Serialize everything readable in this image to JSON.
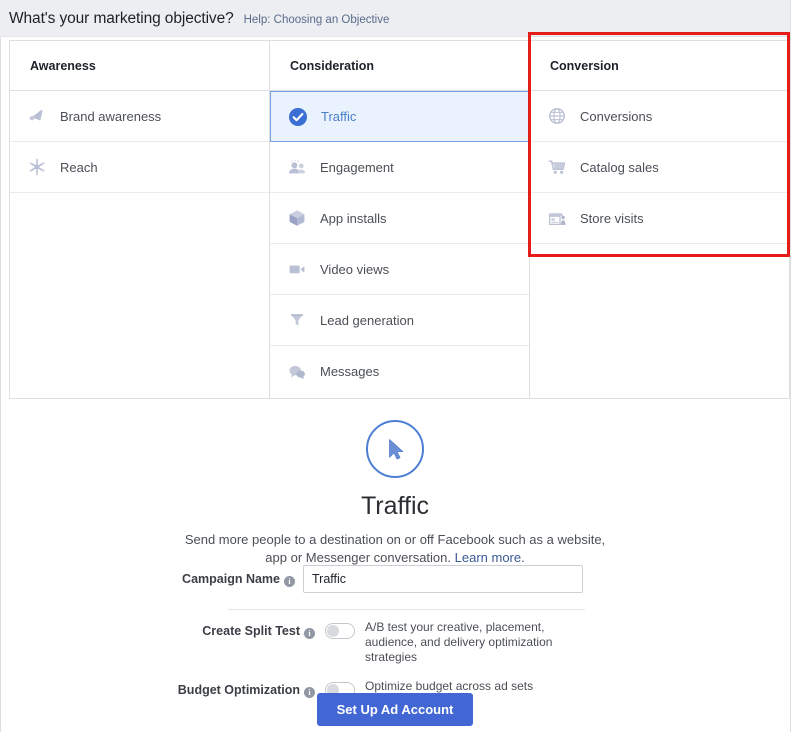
{
  "header": {
    "title": "What's your marketing objective?",
    "help_link": "Help: Choosing an Objective"
  },
  "columns": [
    {
      "name": "awareness",
      "header": "Awareness",
      "items": [
        {
          "label": "Brand awareness",
          "icon": "megaphone-icon",
          "selected": false
        },
        {
          "label": "Reach",
          "icon": "reach-starburst-icon",
          "selected": false
        }
      ]
    },
    {
      "name": "consideration",
      "header": "Consideration",
      "items": [
        {
          "label": "Traffic",
          "icon": "check-circle-icon",
          "selected": true
        },
        {
          "label": "Engagement",
          "icon": "people-icon",
          "selected": false
        },
        {
          "label": "App installs",
          "icon": "cube-icon",
          "selected": false
        },
        {
          "label": "Video views",
          "icon": "video-camera-icon",
          "selected": false
        },
        {
          "label": "Lead generation",
          "icon": "funnel-icon",
          "selected": false
        },
        {
          "label": "Messages",
          "icon": "speech-bubbles-icon",
          "selected": false
        }
      ]
    },
    {
      "name": "conversion",
      "header": "Conversion",
      "items": [
        {
          "label": "Conversions",
          "icon": "globe-icon",
          "selected": false
        },
        {
          "label": "Catalog sales",
          "icon": "shopping-cart-icon",
          "selected": false
        },
        {
          "label": "Store visits",
          "icon": "storefront-icon",
          "selected": false
        }
      ]
    }
  ],
  "annotation": {
    "type": "red-highlight-box",
    "target_column": "Conversion",
    "color": "#e81b1b"
  },
  "detail": {
    "icon": "cursor-arrow-icon",
    "title": "Traffic",
    "description": "Send more people to a destination on or off Facebook such as a website, app or Messenger conversation.",
    "learn_more": "Learn more."
  },
  "form": {
    "campaign_name": {
      "label": "Campaign Name",
      "value": "Traffic",
      "placeholder": "Campaign Name",
      "info_icon": "info-icon"
    },
    "split_test": {
      "label": "Create Split Test",
      "info_icon": "info-icon",
      "state": "off",
      "description": "A/B test your creative, placement, audience, and delivery optimization strategies"
    },
    "budget_optimization": {
      "label": "Budget Optimization",
      "info_icon": "info-icon",
      "state": "off",
      "description": "Optimize budget across ad sets"
    },
    "submit_button": "Set Up Ad Account"
  },
  "colors": {
    "accent_blue": "#4267d4",
    "selected_row_bg": "#eaf2fd",
    "selected_row_border": "#74a2e0",
    "topbar_bg": "#eceef1",
    "annotation_red": "#e81b1b"
  }
}
